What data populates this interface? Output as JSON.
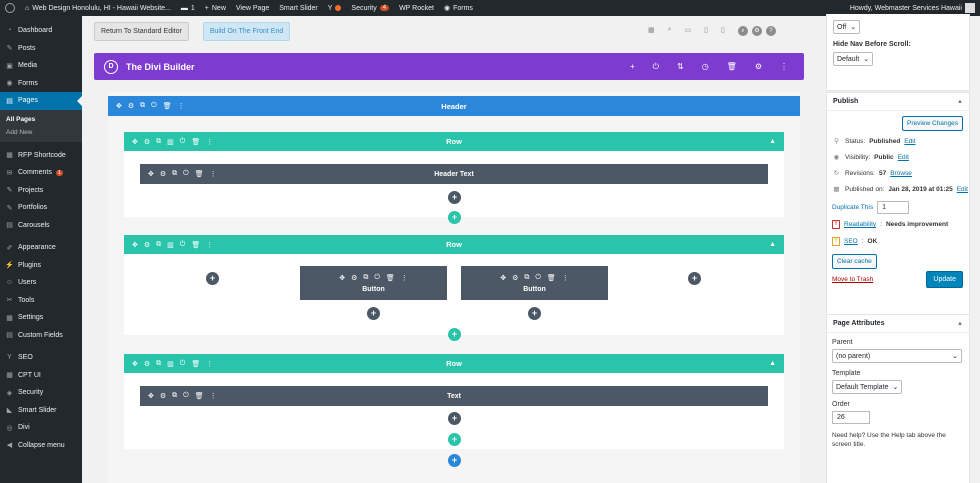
{
  "adminbar": {
    "site_name": "Web Design Honolulu, HI - Hawaii Website...",
    "comments_count": "1",
    "new_label": "New",
    "view_page": "View Page",
    "smart_slider": "Smart Slider",
    "security": "Security",
    "security_badge": "4",
    "wp_rocket": "WP Rocket",
    "forms": "Forms",
    "howdy": "Howdy, Webmaster Services Hawaii"
  },
  "sidebar": {
    "items": [
      {
        "label": "Dashboard",
        "icon": "dashboard-icon",
        "glyph": "◔"
      },
      {
        "label": "Posts",
        "icon": "pin-icon",
        "glyph": "✎"
      },
      {
        "label": "Media",
        "icon": "media-icon",
        "glyph": "▣"
      },
      {
        "label": "Forms",
        "icon": "forms-icon",
        "glyph": "◉"
      },
      {
        "label": "Pages",
        "icon": "pages-icon",
        "glyph": "▤"
      }
    ],
    "sub_all_pages": "All Pages",
    "sub_add_new": "Add New",
    "items2": [
      {
        "label": "RFP Shortcode",
        "icon": "shortcode-icon",
        "glyph": "▦"
      },
      {
        "label": "Comments",
        "icon": "comment-icon",
        "glyph": "✉",
        "count": "1"
      },
      {
        "label": "Projects",
        "icon": "projects-icon",
        "glyph": "✎"
      },
      {
        "label": "Portfolios",
        "icon": "portfolios-icon",
        "glyph": "✎"
      },
      {
        "label": "Carousels",
        "icon": "carousels-icon",
        "glyph": "▤"
      }
    ],
    "items3": [
      {
        "label": "Appearance",
        "icon": "brush-icon",
        "glyph": "✐"
      },
      {
        "label": "Plugins",
        "icon": "plugin-icon",
        "glyph": "⚡"
      },
      {
        "label": "Users",
        "icon": "users-icon",
        "glyph": "☺"
      },
      {
        "label": "Tools",
        "icon": "tools-icon",
        "glyph": "✂"
      },
      {
        "label": "Settings",
        "icon": "settings-icon",
        "glyph": "▦"
      },
      {
        "label": "Custom Fields",
        "icon": "custom-fields-icon",
        "glyph": "▤"
      }
    ],
    "items4": [
      {
        "label": "SEO",
        "icon": "seo-icon",
        "glyph": "Y"
      },
      {
        "label": "CPT UI",
        "icon": "cpt-icon",
        "glyph": "▦"
      },
      {
        "label": "Security",
        "icon": "shield-icon",
        "glyph": "◈"
      },
      {
        "label": "Smart Slider",
        "icon": "slider-icon",
        "glyph": "◣"
      },
      {
        "label": "Divi",
        "icon": "divi-icon",
        "glyph": "◎"
      },
      {
        "label": "Collapse menu",
        "icon": "collapse-icon",
        "glyph": "◀"
      }
    ]
  },
  "toolbar": {
    "return_label": "Return To Standard Editor",
    "front_end_label": "Build On The Front End"
  },
  "builder": {
    "title": "The Divi Builder",
    "logo_letter": "D",
    "section_title": "Header",
    "rows": [
      {
        "title": "Row",
        "module": "Header Text"
      },
      {
        "title": "Row",
        "modules": [
          "Button",
          "Button"
        ]
      },
      {
        "title": "Row",
        "module": "Text"
      }
    ]
  },
  "rightcol": {
    "top_select_value": "Off",
    "hide_nav_label": "Hide Nav Before Scroll:",
    "hide_nav_value": "Default",
    "publish": {
      "title": "Publish",
      "preview_label": "Preview Changes",
      "status_label": "Status:",
      "status_value": "Published",
      "visibility_label": "Visibility:",
      "visibility_value": "Public",
      "revisions_label": "Revisions:",
      "revisions_value": "57",
      "browse": "Browse",
      "published_on_label": "Published on:",
      "published_on_value": "Jan 28, 2019 at 01:25",
      "edit": "Edit",
      "duplicate_label": "Duplicate This",
      "duplicate_value": "1",
      "readability_label": "Readability",
      "readability_value": "Needs improvement",
      "seo_label": "SEO",
      "seo_value": "OK",
      "clear_cache": "Clear cache",
      "move_trash": "Move to Trash",
      "update": "Update"
    },
    "attributes": {
      "title": "Page Attributes",
      "parent_label": "Parent",
      "parent_value": "(no parent)",
      "template_label": "Template",
      "template_value": "Default Template",
      "order_label": "Order",
      "order_value": "26",
      "help_text": "Need help? Use the Help tab above the screen title."
    }
  }
}
